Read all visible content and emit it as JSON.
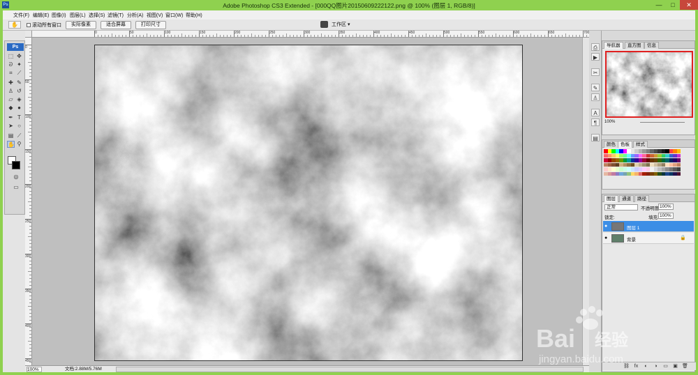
{
  "titlebar": {
    "app_icon": "Ps",
    "title": "Adobe Photoshop CS3 Extended - [000QQ图片20150609222122.png @ 100% (图层 1, RGB/8)]",
    "minimize": "—",
    "maximize": "□",
    "close": "✕"
  },
  "menu": {
    "items": [
      "文件(F)",
      "编辑(E)",
      "图像(I)",
      "图层(L)",
      "选择(S)",
      "滤镜(T)",
      "分析(A)",
      "视图(V)",
      "窗口(W)",
      "帮助(H)"
    ]
  },
  "options": {
    "scroll_all_label": "滚动所有窗口",
    "actual_pixels": "实际像素",
    "fit_screen": "适合屏幕",
    "print_size": "打印尺寸",
    "workspace": "工作区 ▾"
  },
  "toolbox": {
    "logo": "Ps",
    "selected_tool": "hand-tool"
  },
  "rulers": {
    "h_labels": [
      "0",
      "50",
      "100",
      "150",
      "200",
      "250",
      "300",
      "350",
      "400",
      "450",
      "500",
      "550",
      "600",
      "650",
      "700",
      "750",
      "800",
      "850",
      "900",
      "950"
    ],
    "v_labels": [
      "0",
      "50",
      "100",
      "150",
      "200",
      "250",
      "300",
      "350",
      "400",
      "450"
    ]
  },
  "status": {
    "zoom": "100%",
    "doc_info": "文档:2.88M/5.76M"
  },
  "navigator": {
    "tabs": [
      "导航器",
      "直方图",
      "信息"
    ],
    "zoom": "100%"
  },
  "swatches": {
    "tabs": [
      "颜色",
      "色板",
      "样式"
    ]
  },
  "layers": {
    "tabs": [
      "图层",
      "通道",
      "路径"
    ],
    "blend_mode": "正常",
    "opacity_label": "不透明度:",
    "opacity": "100%",
    "lock_label": "锁定:",
    "fill_label": "填充:",
    "fill": "100%",
    "items": [
      {
        "name": "图层 1",
        "selected": true
      },
      {
        "name": "背景",
        "selected": false
      }
    ]
  },
  "watermark": {
    "brand_text": "Bai",
    "brand_suffix": "经验",
    "url": "jingyan.baidu.com"
  },
  "colors": {
    "window_frame": "#8fd14f",
    "selected_layer": "#3c8ee6",
    "navigator_frame": "#e02020",
    "canvas_bg": "#bfbfbf"
  }
}
